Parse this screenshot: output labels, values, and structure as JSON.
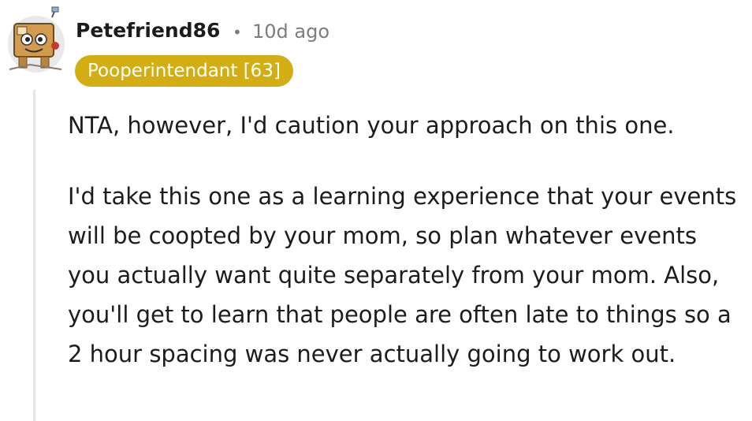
{
  "comment": {
    "author": "Petefriend86",
    "separator": "•",
    "timestamp": "10d ago",
    "flair": "Pooperintendant [63]",
    "paragraphs": [
      "NTA, however, I'd caution your approach on this one.",
      "I'd take this one as a learning experience that your events will be coopted by your mom, so plan whatever events you actually want quite separately from your mom. Also, you'll get to learn that people are often late to things so a 2 hour spacing was never actually going to work out."
    ]
  },
  "avatar": {
    "icon": "robot-avatar-icon",
    "bg_color": "#e9e9e9",
    "body_color": "#d39b4f",
    "accent_color": "#c7392f"
  },
  "colors": {
    "flair_bg": "#d2ae12",
    "meta_text": "#7c7c7c",
    "body_text": "#1c1c1c",
    "thread_line": "#e5e5e5"
  }
}
